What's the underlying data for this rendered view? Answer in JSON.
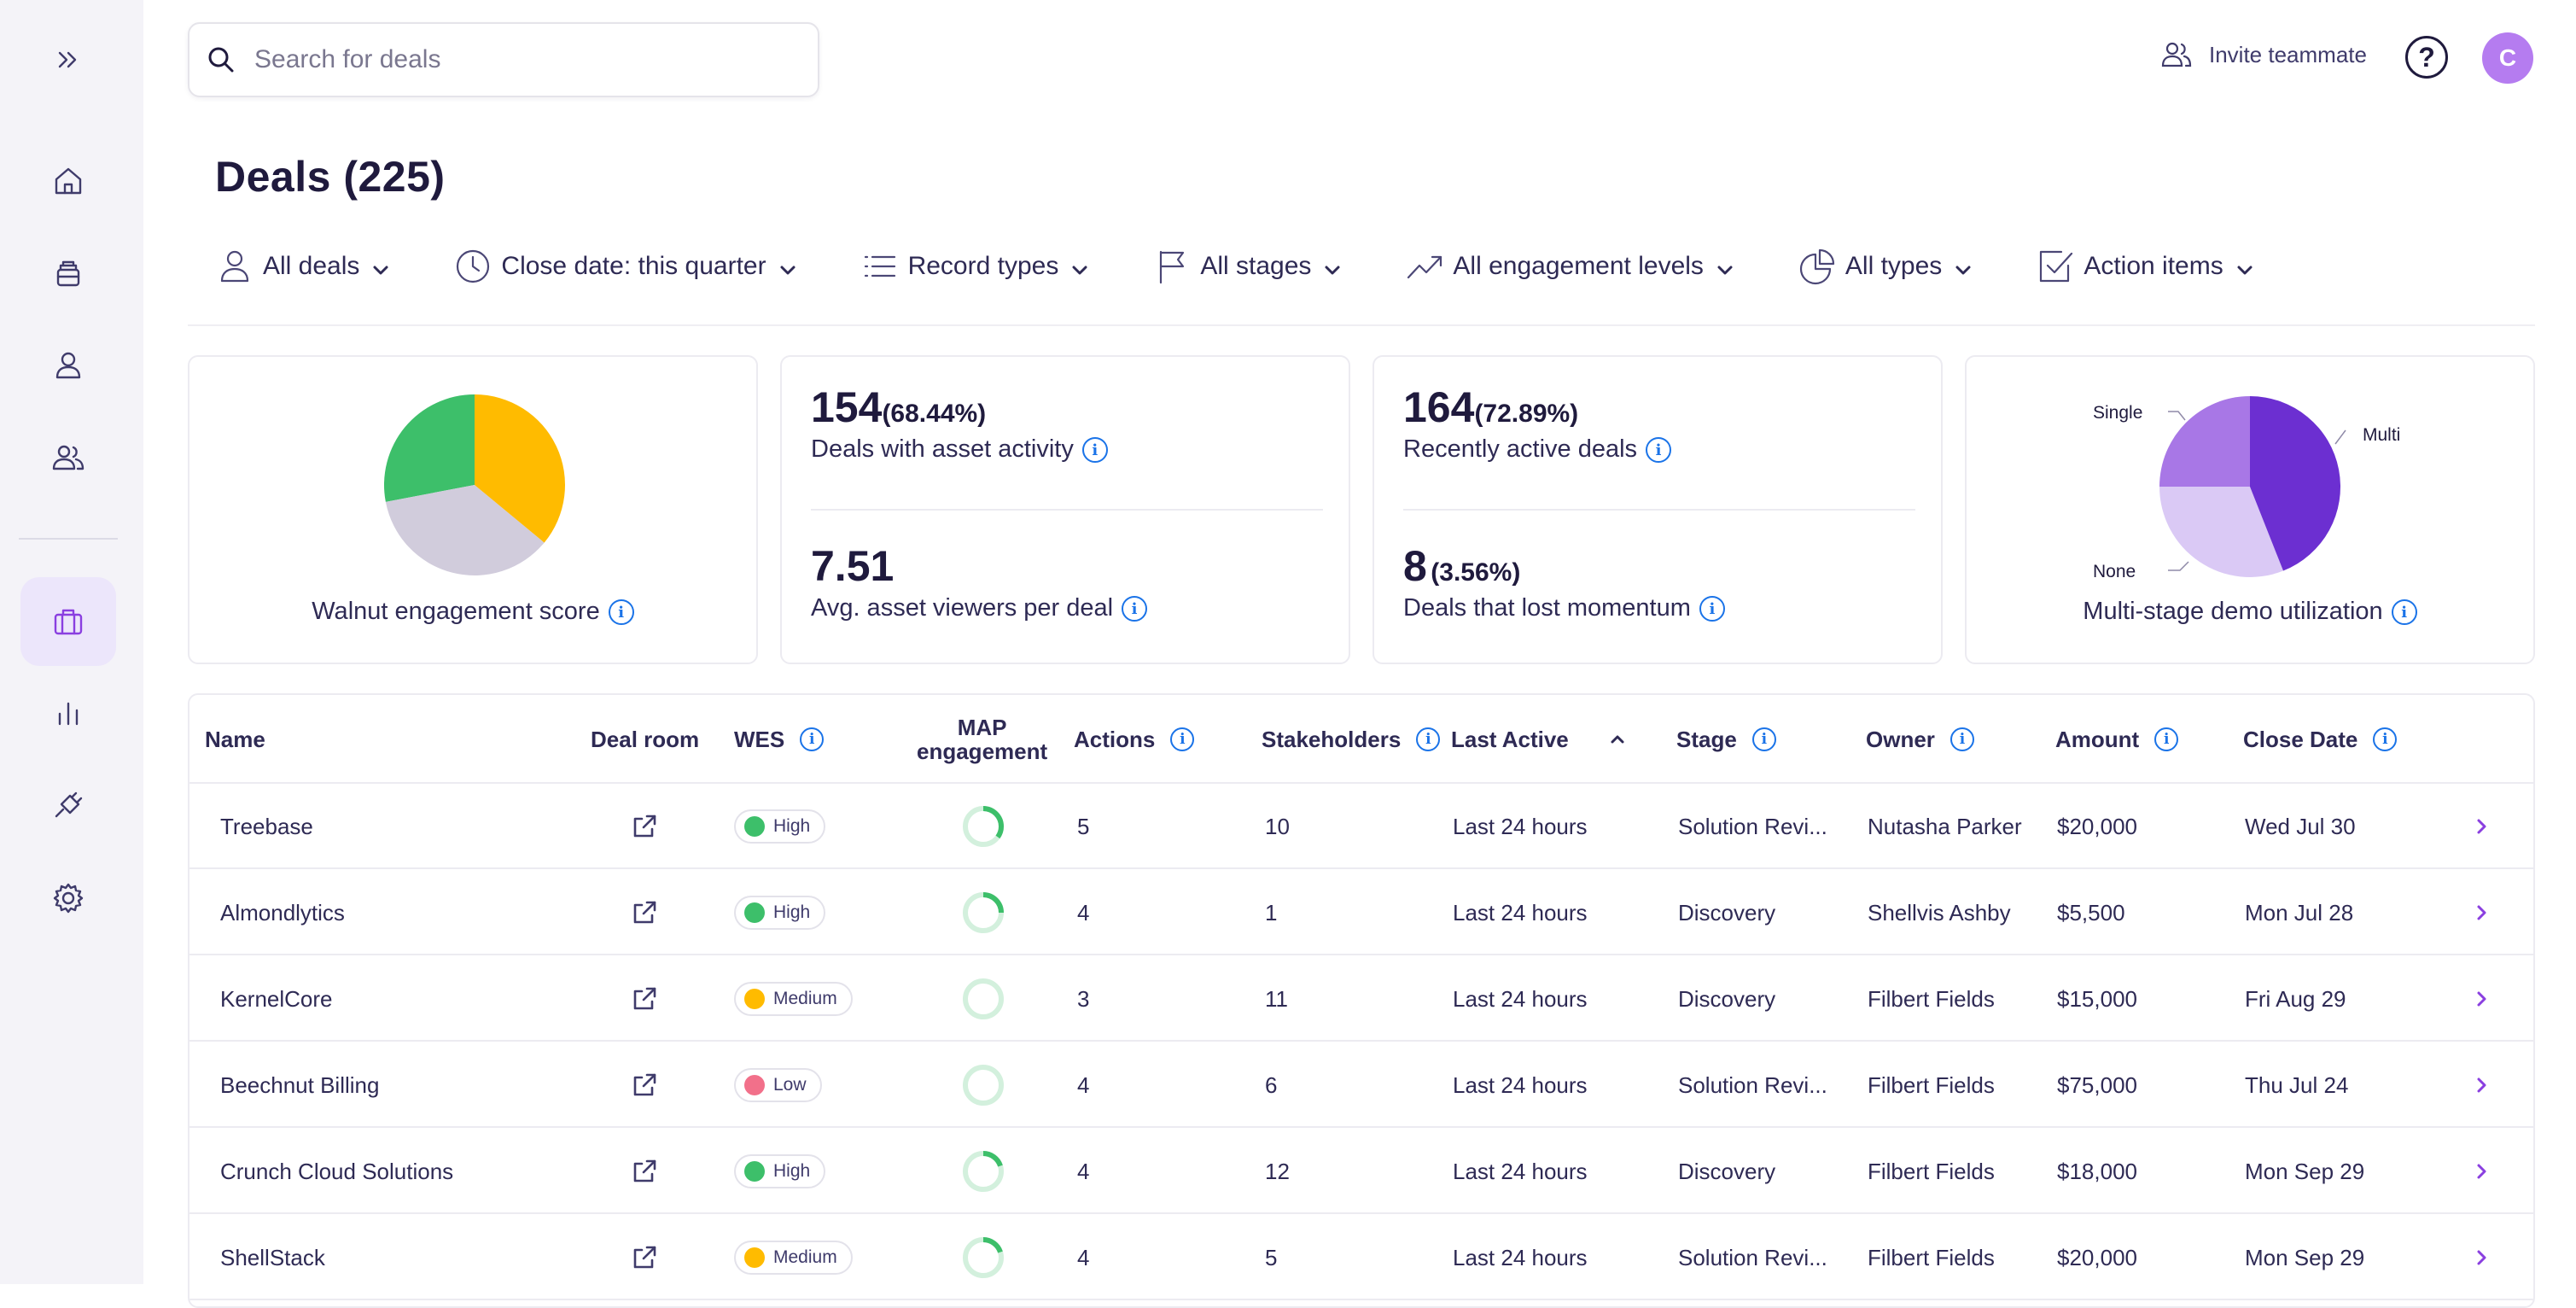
{
  "search": {
    "placeholder": "Search for deals"
  },
  "header": {
    "invite_label": "Invite teammate",
    "help_label": "?",
    "avatar_initial": "C"
  },
  "page": {
    "title": "Deals (225)"
  },
  "filters": [
    {
      "label": "All deals",
      "icon": "person-icon"
    },
    {
      "label": "Close date: this quarter",
      "icon": "clock-icon"
    },
    {
      "label": "Record types",
      "icon": "list-icon"
    },
    {
      "label": "All stages",
      "icon": "flag-icon"
    },
    {
      "label": "All engagement levels",
      "icon": "trending-up-icon"
    },
    {
      "label": "All types",
      "icon": "pie-icon"
    },
    {
      "label": "Action items",
      "icon": "checkbox-icon"
    }
  ],
  "cards": {
    "engagement": {
      "caption": "Walnut engagement score"
    },
    "assets": {
      "top_value": "154",
      "top_pct": "(68.44%)",
      "top_label": "Deals with asset activity",
      "bottom_value": "7.51",
      "bottom_label": "Avg. asset viewers per deal"
    },
    "activity": {
      "top_value": "164",
      "top_pct": "(72.89%)",
      "top_label": "Recently active deals",
      "bottom_value": "8",
      "bottom_pct": "(3.56%)",
      "bottom_label": "Deals that lost momentum"
    },
    "demo": {
      "caption": "Multi-stage demo utilization",
      "labels": {
        "single": "Single",
        "multi": "Multi",
        "none": "None"
      }
    }
  },
  "chart_data": [
    {
      "type": "pie",
      "title": "Walnut engagement score",
      "slices": [
        {
          "name": "",
          "value": 0.36,
          "color": "#ffbb00"
        },
        {
          "name": "",
          "value": 0.36,
          "color": "#d1ccdc"
        },
        {
          "name": "",
          "value": 0.28,
          "color": "#3dbf6a"
        }
      ]
    },
    {
      "type": "pie",
      "title": "Multi-stage demo utilization",
      "slices": [
        {
          "name": "Multi",
          "value": 0.44,
          "color": "#6c2fd1"
        },
        {
          "name": "None",
          "value": 0.31,
          "color": "#dac9f5"
        },
        {
          "name": "Single",
          "value": 0.25,
          "color": "#a877e6"
        }
      ]
    }
  ],
  "table": {
    "headers": {
      "name": "Name",
      "deal_room": "Deal room",
      "wes": "WES",
      "map_line1": "MAP",
      "map_line2": "engagement",
      "actions": "Actions",
      "stakeholders": "Stakeholders",
      "last_active": "Last Active",
      "stage": "Stage",
      "owner": "Owner",
      "amount": "Amount",
      "close_date": "Close Date"
    },
    "wes_colors": {
      "High": "#3dbf6a",
      "Medium": "#ffbb00",
      "Low": "#f2708a"
    },
    "rows": [
      {
        "name": "Treebase",
        "wes": "High",
        "map": 0.35,
        "actions": "5",
        "stakeholders": "10",
        "last_active": "Last 24 hours",
        "stage": "Solution Revi...",
        "owner": "Nutasha Parker",
        "amount": "$20,000",
        "close_date": "Wed Jul 30"
      },
      {
        "name": "Almondlytics",
        "wes": "High",
        "map": 0.25,
        "actions": "4",
        "stakeholders": "1",
        "last_active": "Last 24 hours",
        "stage": "Discovery",
        "owner": "Shellvis Ashby",
        "amount": "$5,500",
        "close_date": "Mon Jul 28"
      },
      {
        "name": "KernelCore",
        "wes": "Medium",
        "map": 0,
        "actions": "3",
        "stakeholders": "11",
        "last_active": "Last 24 hours",
        "stage": "Discovery",
        "owner": "Filbert Fields",
        "amount": "$15,000",
        "close_date": "Fri Aug 29"
      },
      {
        "name": "Beechnut Billing",
        "wes": "Low",
        "map": 0,
        "actions": "4",
        "stakeholders": "6",
        "last_active": "Last 24 hours",
        "stage": "Solution Revi...",
        "owner": "Filbert Fields",
        "amount": "$75,000",
        "close_date": "Thu Jul 24"
      },
      {
        "name": "Crunch Cloud Solutions",
        "wes": "High",
        "map": 0.2,
        "actions": "4",
        "stakeholders": "12",
        "last_active": "Last 24 hours",
        "stage": "Discovery",
        "owner": "Filbert Fields",
        "amount": "$18,000",
        "close_date": "Mon Sep 29"
      },
      {
        "name": "ShellStack",
        "wes": "Medium",
        "map": 0.2,
        "actions": "4",
        "stakeholders": "5",
        "last_active": "Last 24 hours",
        "stage": "Solution Revi...",
        "owner": "Filbert Fields",
        "amount": "$20,000",
        "close_date": "Mon Sep 29"
      }
    ]
  }
}
